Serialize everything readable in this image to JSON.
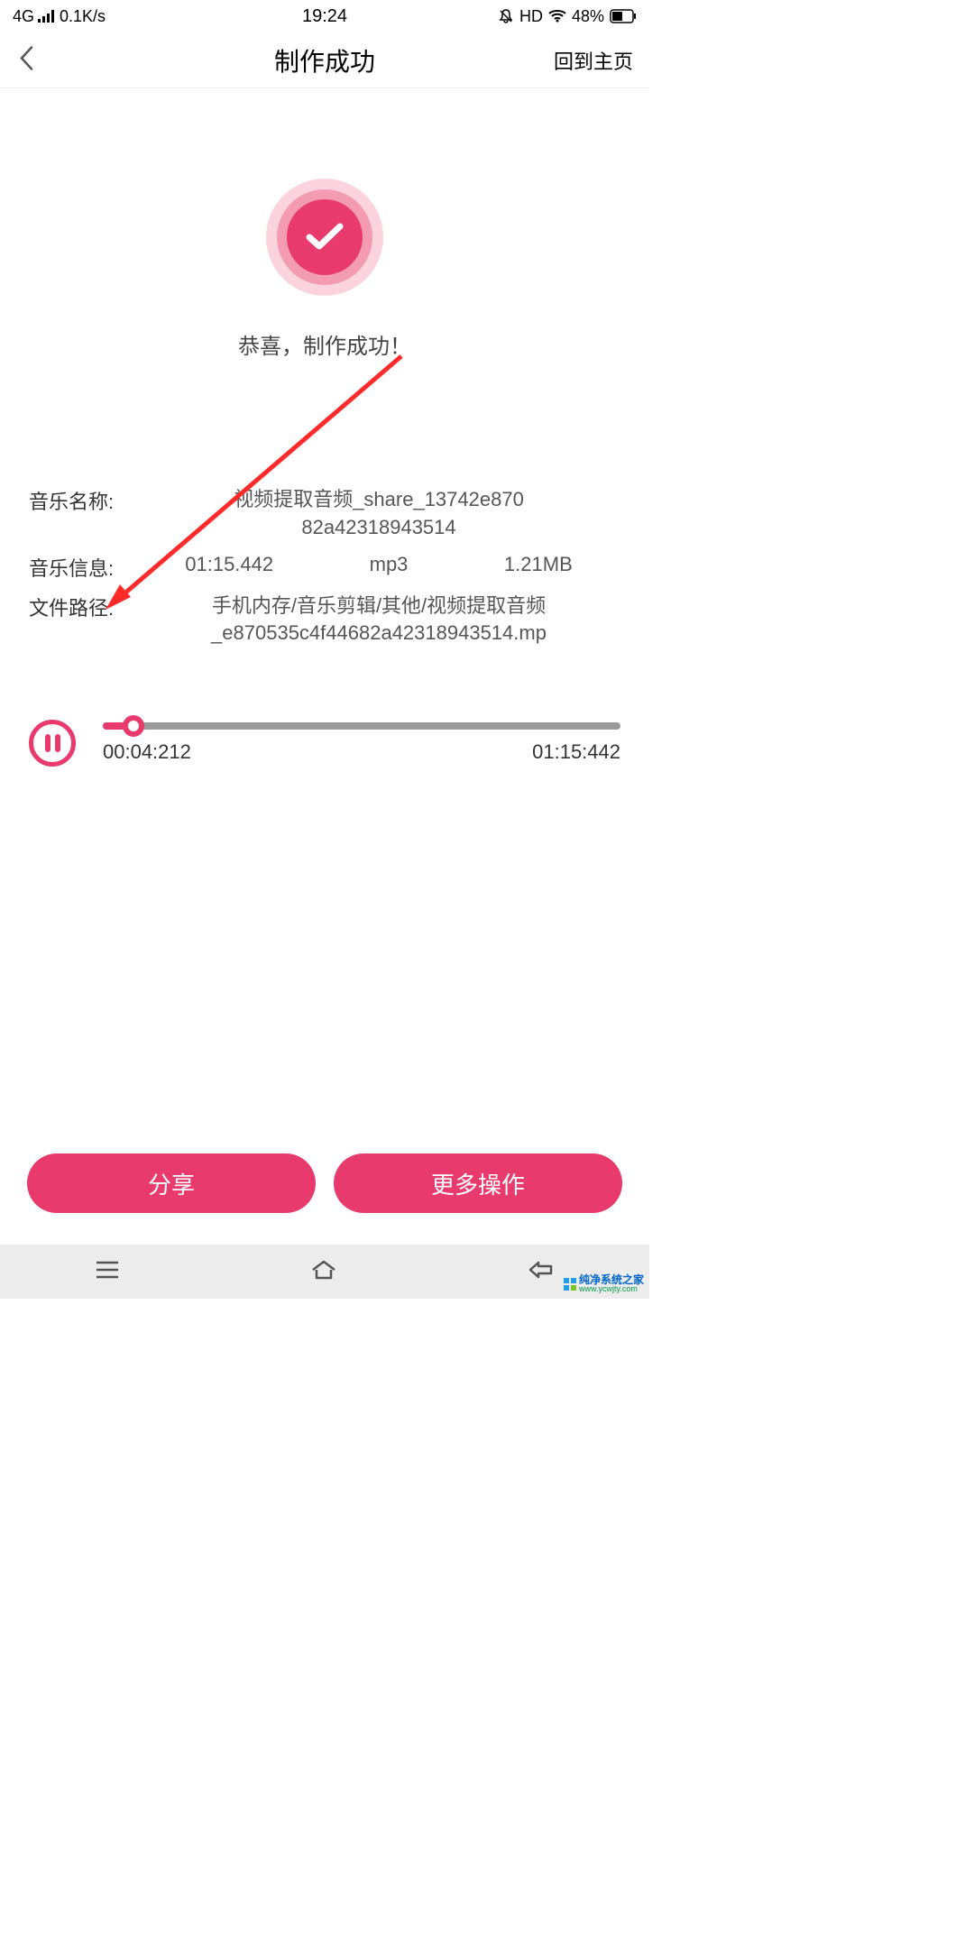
{
  "status": {
    "network": "4G",
    "speed": "0.1K/s",
    "time": "19:24",
    "hd": "HD",
    "battery_pct": "48%"
  },
  "header": {
    "title": "制作成功",
    "home": "回到主页"
  },
  "success_message": "恭喜，制作成功！",
  "info": {
    "name_label": "音乐名称:",
    "name_value": "视频提取音频_share_13742e870",
    "name_value2": "82a42318943514",
    "meta_label": "音乐信息:",
    "duration": "01:15.442",
    "format": "mp3",
    "size": "1.21MB",
    "path_label": "文件路径:",
    "path_value": "手机内存/音乐剪辑/其他/视频提取音频_e870535c4f44682a42318943514.mp"
  },
  "player": {
    "current_time": "00:04:212",
    "total_time": "01:15:442"
  },
  "buttons": {
    "share": "分享",
    "more": "更多操作"
  },
  "watermark": {
    "title": "纯净系统之家",
    "url": "www.ycwjty.com"
  }
}
